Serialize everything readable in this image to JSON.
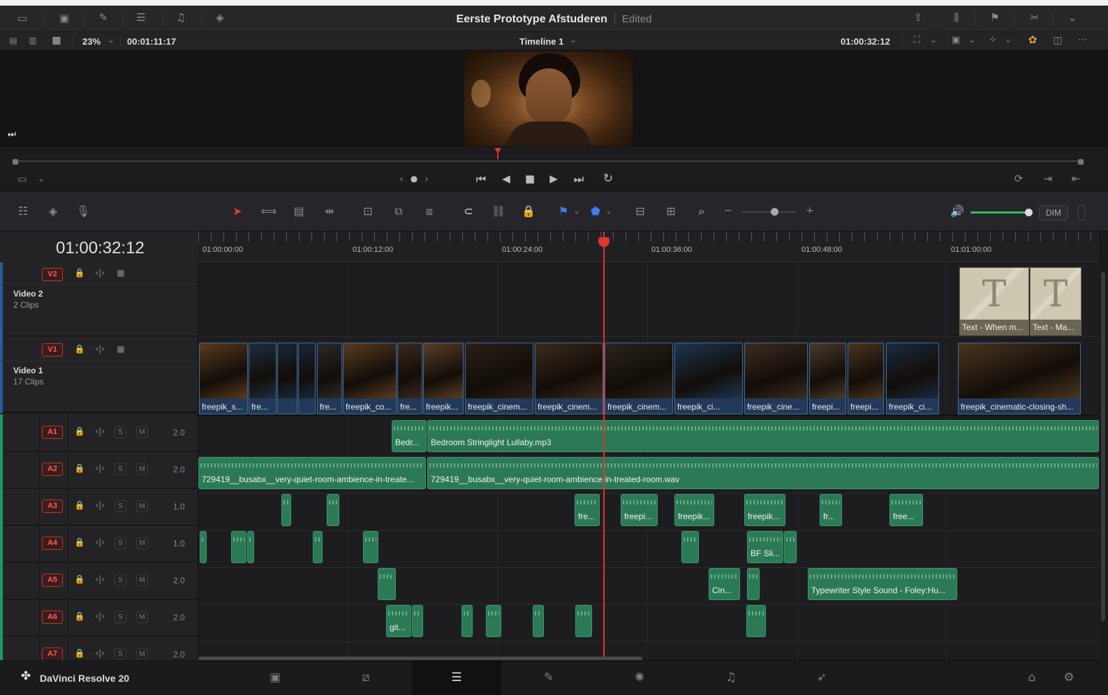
{
  "app": {
    "project_title": "Eerste Prototype Afstuderen",
    "status": "Edited",
    "brand": "DaVinci Resolve 20"
  },
  "viewer_bar": {
    "zoom": "23%",
    "duration": "00:01:11:17",
    "timeline_name": "Timeline 1",
    "timecode": "01:00:32:12"
  },
  "toolbar": {
    "dim_label": "DIM"
  },
  "timeline": {
    "current_timecode": "01:00:32:12",
    "ruler": [
      "01:00:00:00",
      "01:00:12:00",
      "01:00:24:00",
      "01:00:36:00",
      "01:00:48:00",
      "01:01:00:00"
    ],
    "video_tracks": [
      {
        "id": "V2",
        "name": "Video 2",
        "count": "2 Clips"
      },
      {
        "id": "V1",
        "name": "Video 1",
        "count": "17 Clips"
      }
    ],
    "audio_tracks": [
      {
        "id": "A1",
        "level": "2.0"
      },
      {
        "id": "A2",
        "level": "2.0"
      },
      {
        "id": "A3",
        "level": "1.0"
      },
      {
        "id": "A4",
        "level": "1.0"
      },
      {
        "id": "A5",
        "level": "2.0"
      },
      {
        "id": "A6",
        "level": "2.0"
      },
      {
        "id": "A7",
        "level": "2.0"
      }
    ],
    "solo": "S",
    "mute": "M",
    "v2_clips": [
      "Text - When m...",
      "Text - Ma..."
    ],
    "v1_clips": [
      "freepik_s...",
      "fre...",
      "",
      "",
      "fre...",
      "freepik_co...",
      "fre...",
      "freepik...",
      "freepik_cinem...",
      "freepik_cinem...",
      "freepik_cinem...",
      "freepik_ci...",
      "freepik_cine...",
      "freepi...",
      "freepi...",
      "freepik_ci...",
      "freepik_cinematic-closing-sh..."
    ],
    "a1_clips": [
      "Bedr...",
      "Bedroom Stringlight Lullaby.mp3"
    ],
    "a2_clips": [
      "729419__busabx__very-quiet-room-ambience-in-treate...",
      "729419__busabx__very-quiet-room-ambience-in-treated-room.wav"
    ],
    "a3_clips": [
      "fre...",
      "freepi...",
      "freepik...",
      "freepik...",
      "fr...",
      "free..."
    ],
    "a4_clips": [
      "BF Sli..."
    ],
    "a5_clips": [
      "Cin...",
      "Typewriter Style Sound  - Foley:Hu..."
    ],
    "a6_clips": [
      "git..."
    ]
  }
}
